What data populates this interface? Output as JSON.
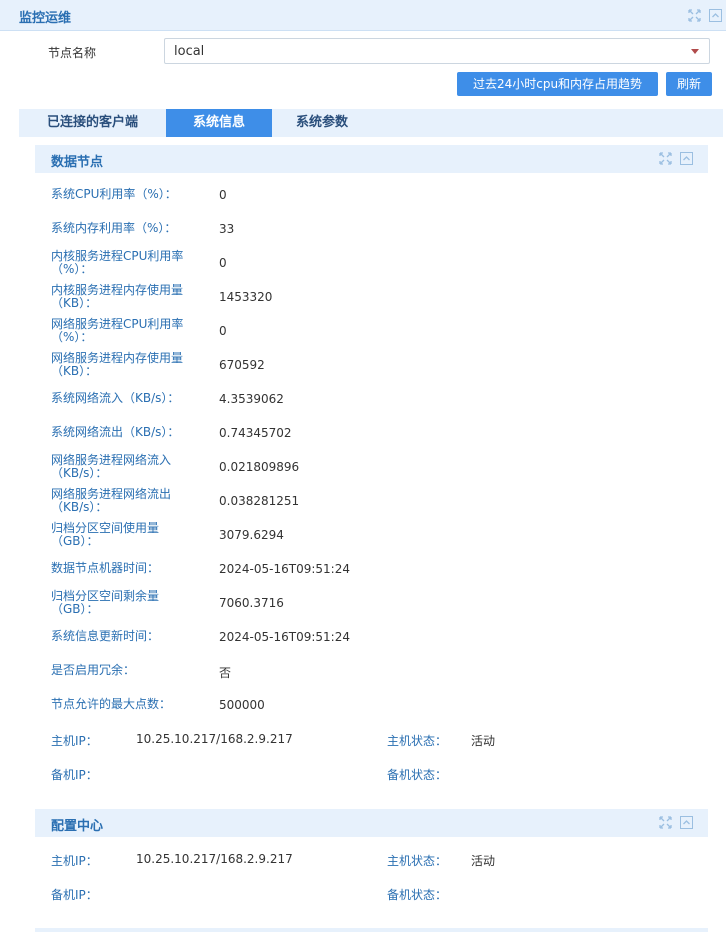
{
  "panel": {
    "title": "监控运维"
  },
  "node": {
    "label": "节点名称",
    "value": "local"
  },
  "buttons": {
    "trend": "过去24小时cpu和内存占用趋势",
    "refresh": "刷新"
  },
  "tabs": [
    {
      "label": "已连接的客户端",
      "active": false
    },
    {
      "label": "系统信息",
      "active": true
    },
    {
      "label": "系统参数",
      "active": false
    }
  ],
  "data_node": {
    "title": "数据节点",
    "rows": [
      {
        "label": "系统CPU利用率（%）：",
        "value": "0"
      },
      {
        "label": "系统内存利用率（%）：",
        "value": "33"
      },
      {
        "label": "内核服务进程CPU利用率（%）：",
        "value": "0"
      },
      {
        "label": "内核服务进程内存使用量（KB）：",
        "value": "1453320"
      },
      {
        "label": "网络服务进程CPU利用率（%）：",
        "value": "0"
      },
      {
        "label": "网络服务进程内存使用量（KB）：",
        "value": "670592"
      },
      {
        "label": "系统网络流入（KB/s）：",
        "value": "4.3539062"
      },
      {
        "label": "系统网络流出（KB/s）：",
        "value": "0.74345702"
      },
      {
        "label": "网络服务进程网络流入（KB/s）：",
        "value": "0.021809896"
      },
      {
        "label": "网络服务进程网络流出（KB/s）：",
        "value": "0.038281251"
      },
      {
        "label": "归档分区空间使用量（GB）：",
        "value": "3079.6294"
      },
      {
        "label": "数据节点机器时间：",
        "value": "2024-05-16T09:51:24"
      },
      {
        "label": "归档分区空间剩余量（GB）：",
        "value": "7060.3716"
      },
      {
        "label": "系统信息更新时间：",
        "value": "2024-05-16T09:51:24"
      },
      {
        "label": "是否启用冗余：",
        "value": "否"
      },
      {
        "label": "节点允许的最大点数：",
        "value": "500000"
      }
    ],
    "host_ip_label": "主机IP：",
    "host_ip": "10.25.10.217/168.2.9.217",
    "host_status_label": "主机状态：",
    "host_status": "活动",
    "standby_ip_label": "备机IP：",
    "standby_ip": "",
    "standby_status_label": "备机状态：",
    "standby_status": ""
  },
  "config_center": {
    "title": "配置中心",
    "host_ip_label": "主机IP：",
    "host_ip": "10.25.10.217/168.2.9.217",
    "host_status_label": "主机状态：",
    "host_status": "活动",
    "standby_ip_label": "备机IP：",
    "standby_ip": "",
    "standby_status_label": "备机状态：",
    "standby_status": ""
  }
}
